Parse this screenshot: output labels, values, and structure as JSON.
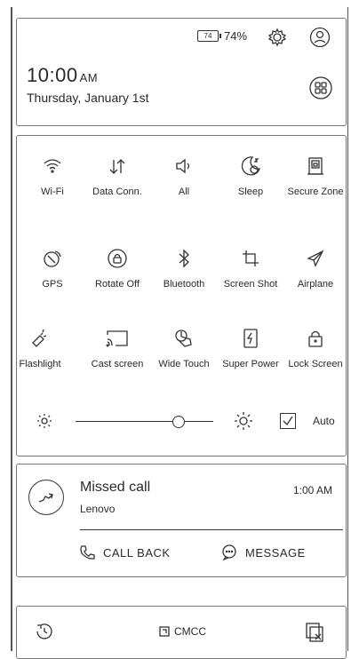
{
  "status": {
    "battery_box": "74",
    "battery_percent": "74%"
  },
  "clock": {
    "time": "10:00",
    "ampm": "AM",
    "date": "Thursday, January 1st"
  },
  "tiles": [
    {
      "label": "Wi-Fi",
      "icon": "wifi-icon"
    },
    {
      "label": "Data Conn.",
      "icon": "data-connection-icon"
    },
    {
      "label": "All",
      "icon": "sound-icon"
    },
    {
      "label": "Sleep",
      "icon": "sleep-icon"
    },
    {
      "label": "Secure Zone",
      "icon": "secure-zone-icon"
    },
    {
      "label": "GPS",
      "icon": "gps-icon"
    },
    {
      "label": "Rotate Off",
      "icon": "rotate-lock-icon"
    },
    {
      "label": "Bluetooth",
      "icon": "bluetooth-icon"
    },
    {
      "label": "Screen Shot",
      "icon": "screenshot-icon"
    },
    {
      "label": "Airplane",
      "icon": "airplane-icon"
    },
    {
      "label": "Flashlight",
      "icon": "flashlight-icon"
    },
    {
      "label": "Cast screen",
      "icon": "cast-screen-icon"
    },
    {
      "label": "Wide Touch",
      "icon": "wide-touch-icon"
    },
    {
      "label": "Super Power",
      "icon": "super-power-icon"
    },
    {
      "label": "Lock Screen",
      "icon": "lock-screen-icon"
    }
  ],
  "brightness": {
    "auto_label": "Auto",
    "level": 0.75
  },
  "notification": {
    "title": "Missed call",
    "subtitle": "Lenovo",
    "time": "1:00 AM",
    "call_back": "CALL BACK",
    "message": "MESSAGE"
  },
  "bottom": {
    "carrier": "CMCC"
  }
}
